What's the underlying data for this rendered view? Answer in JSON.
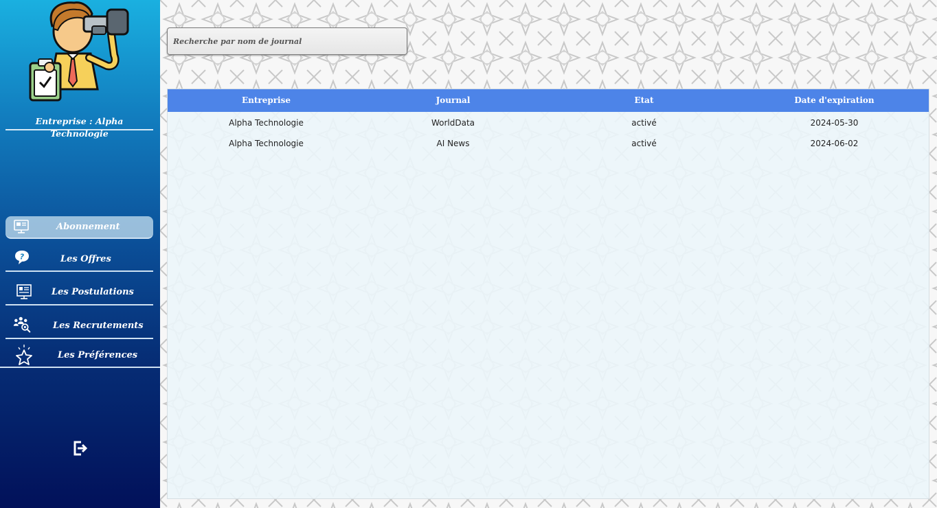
{
  "sidebar": {
    "company_label": "Entreprise : Alpha Technologie",
    "items": [
      {
        "label": "Abonnement",
        "icon": "subscription-icon",
        "active": true
      },
      {
        "label": "Les Offres",
        "icon": "question-bubble-icon",
        "active": false
      },
      {
        "label": "Les Postulations",
        "icon": "application-form-icon",
        "active": false
      },
      {
        "label": "Les Recrutements",
        "icon": "people-search-icon",
        "active": false
      },
      {
        "label": "Les Préférences",
        "icon": "star-icon",
        "active": false
      }
    ],
    "logout_icon": "logout-icon"
  },
  "search": {
    "placeholder": "Recherche par nom de journal",
    "value": ""
  },
  "table": {
    "headers": [
      "Entreprise",
      "Journal",
      "Etat",
      "Date d'expiration"
    ],
    "rows": [
      [
        "Alpha Technologie",
        "WorldData",
        "activé",
        "2024-05-30"
      ],
      [
        "Alpha Technologie",
        "AI News",
        "activé",
        "2024-06-02"
      ]
    ]
  },
  "colors": {
    "header_bg": "#4d84e8",
    "sidebar_top": "#1ab0e0",
    "sidebar_bottom": "#02115a",
    "active_item_bg": "#c8e1f0"
  }
}
